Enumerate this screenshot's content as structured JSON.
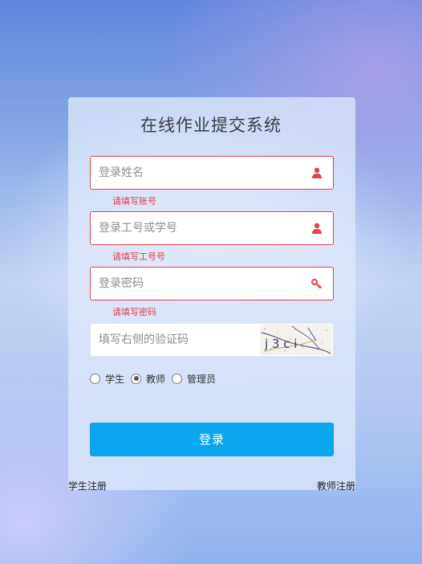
{
  "title": "在线作业提交系统",
  "fields": {
    "name": {
      "placeholder": "登录姓名",
      "error": "请填写账号",
      "icon": "user-icon"
    },
    "id": {
      "placeholder": "登录工号或学号",
      "error": "请填写工号号",
      "icon": "user-icon"
    },
    "password": {
      "placeholder": "登录密码",
      "error": "请填写密码",
      "icon": "key-icon"
    },
    "captcha": {
      "placeholder": "填写右侧的验证码",
      "image_text": "j 3 c i"
    }
  },
  "roles": {
    "student": "学生",
    "teacher": "教师",
    "admin": "管理员",
    "selected": "教师"
  },
  "login_button": "登录",
  "links": {
    "student_register": "学生注册",
    "teacher_register": "教师注册"
  },
  "colors": {
    "error": "#e23c48",
    "button": "#0aa7ee"
  }
}
